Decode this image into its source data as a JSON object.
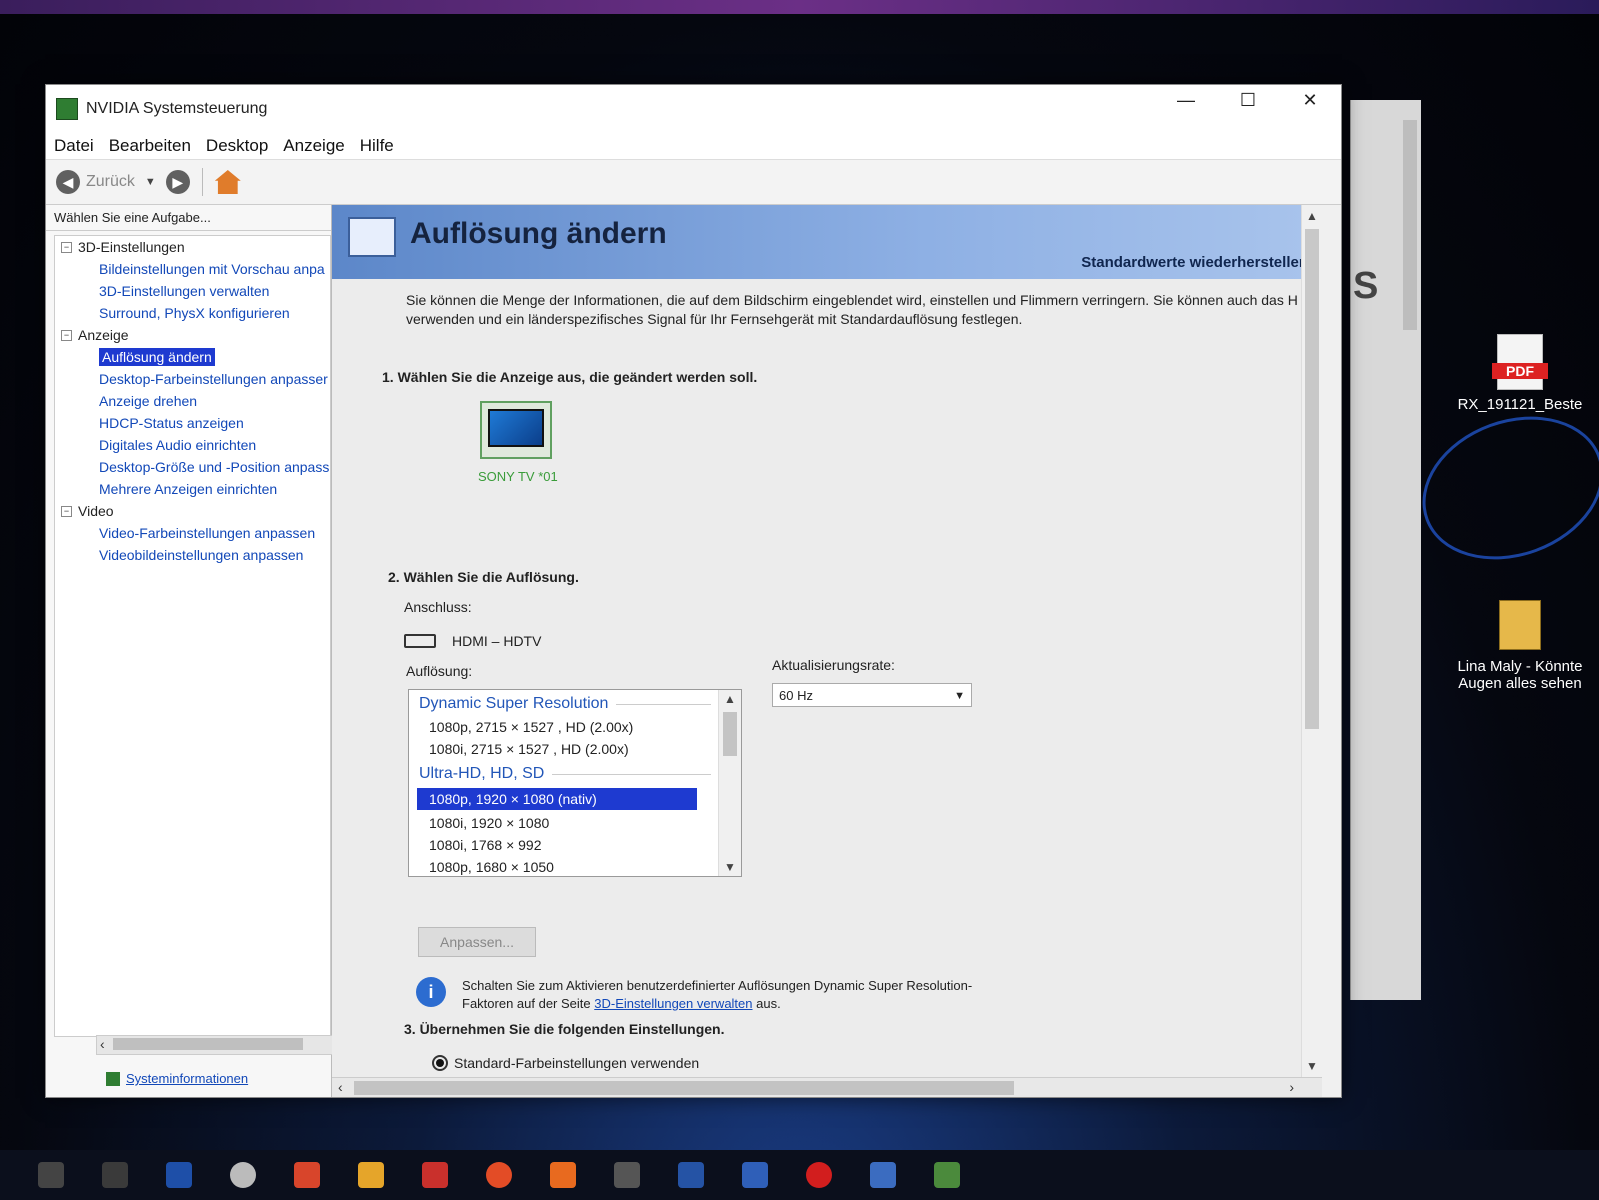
{
  "window": {
    "title": "NVIDIA Systemsteuerung",
    "controls": {
      "minimize": "—",
      "maximize": "☐",
      "close": "✕"
    }
  },
  "menu": [
    "Datei",
    "Bearbeiten",
    "Desktop",
    "Anzeige",
    "Hilfe"
  ],
  "toolbar": {
    "back_label": "Zurück"
  },
  "sidebar": {
    "caption": "Wählen Sie eine Aufgabe...",
    "categories": [
      {
        "label": "3D-Einstellungen",
        "items": [
          "Bildeinstellungen mit Vorschau anpa",
          "3D-Einstellungen verwalten",
          "Surround, PhysX konfigurieren"
        ]
      },
      {
        "label": "Anzeige",
        "items": [
          "Auflösung ändern",
          "Desktop-Farbeinstellungen anpasser",
          "Anzeige drehen",
          "HDCP-Status anzeigen",
          "Digitales Audio einrichten",
          "Desktop-Größe und -Position anpass",
          "Mehrere Anzeigen einrichten"
        ]
      },
      {
        "label": "Video",
        "items": [
          "Video-Farbeinstellungen anpassen",
          "Videobildeinstellungen anpassen"
        ]
      }
    ],
    "system_info": "Systeminformationen"
  },
  "page": {
    "title": "Auflösung ändern",
    "restore_defaults": "Standardwerte wiederherstellen",
    "intro_line1": "Sie können die Menge der Informationen, die auf dem Bildschirm eingeblendet wird, einstellen und Flimmern verringern. Sie können auch das H",
    "intro_line2": "verwenden und ein länderspezifisches Signal für Ihr Fernsehgerät mit Standardauflösung festlegen.",
    "step1": "1. Wählen Sie die Anzeige aus, die geändert werden soll.",
    "display_name": "SONY TV  *01",
    "step2": "2. Wählen Sie die Auflösung.",
    "connection_label": "Anschluss:",
    "connection_value": "HDMI – HDTV",
    "resolution_label": "Auflösung:",
    "refresh_label": "Aktualisierungsrate:",
    "refresh_value": "60 Hz",
    "resolution_groups": [
      {
        "label": "Dynamic Super Resolution",
        "items": [
          "1080p, 2715 × 1527 , HD (2.00x)",
          "1080i, 2715 × 1527 , HD (2.00x)"
        ]
      },
      {
        "label": "Ultra-HD, HD, SD",
        "items": [
          "1080p, 1920 × 1080 (nativ)",
          "1080i, 1920 × 1080",
          "1080i, 1768 × 992",
          "1080p, 1680 × 1050"
        ]
      }
    ],
    "selected_resolution": "1080p, 1920 × 1080 (nativ)",
    "customize_button": "Anpassen...",
    "info_text_pre": "Schalten Sie zum Aktivieren benutzerdefinierter Auflösungen Dynamic Super Resolution-Faktoren auf der Seite ",
    "info_link": "3D-Einstellungen verwalten",
    "info_text_post": " aus.",
    "step3": "3. Übernehmen Sie die folgenden Einstellungen.",
    "color_option": "Standard-Farbeinstellungen verwenden"
  },
  "desktop": {
    "pdf_badge": "PDF",
    "pdf_label": "RX_191121_Beste",
    "folder_label_line1": "Lina Maly - Könnte",
    "folder_label_line2": "Augen alles sehen"
  }
}
